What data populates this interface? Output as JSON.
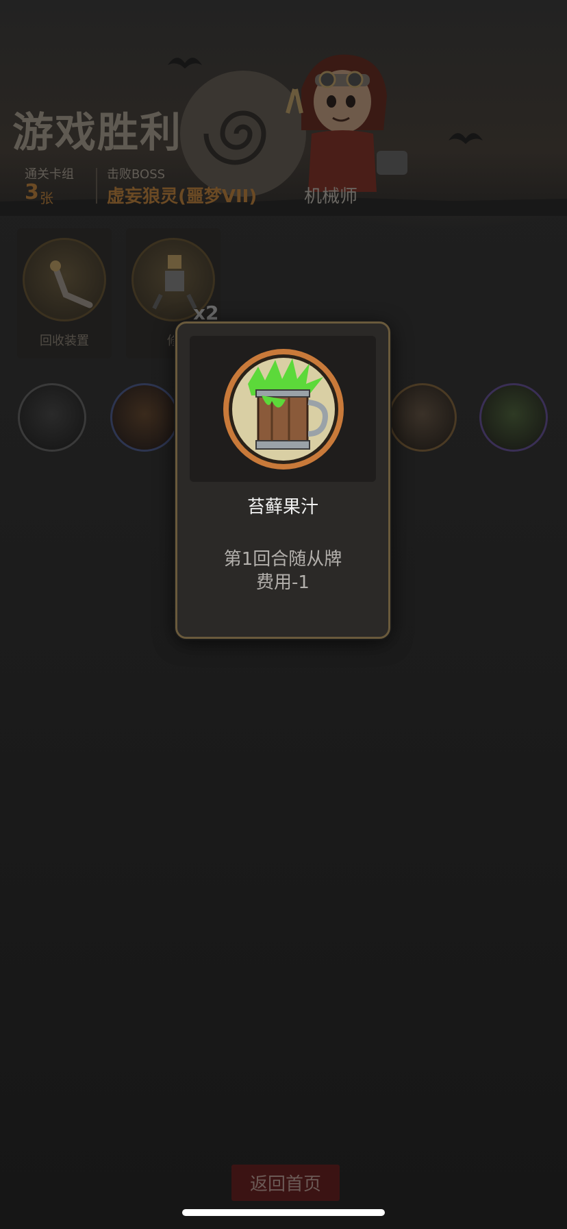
{
  "header": {
    "title": "游戏胜利",
    "deck_label": "通关卡组",
    "deck_count": "3",
    "deck_unit": "张",
    "boss_label": "击败BOSS",
    "boss_name": "虚妄狼灵(噩梦VII)",
    "class_name": "机械师"
  },
  "rewards": [
    {
      "label": "回收装置"
    },
    {
      "label": "修"
    }
  ],
  "reward_multiplier": "x2",
  "modal": {
    "name": "苔藓果汁",
    "description_line1": "第1回合随从牌",
    "description_line2": "费用-1",
    "icon": "moss-juice-mug-icon"
  },
  "footer": {
    "home_button": "返回首页"
  },
  "colors": {
    "background": "#1b1b1b",
    "modal_border": "#6a5a3c",
    "accent_orange": "#c97a3a",
    "potion_green": "#5cd93a",
    "button_red": "#3b1313"
  }
}
